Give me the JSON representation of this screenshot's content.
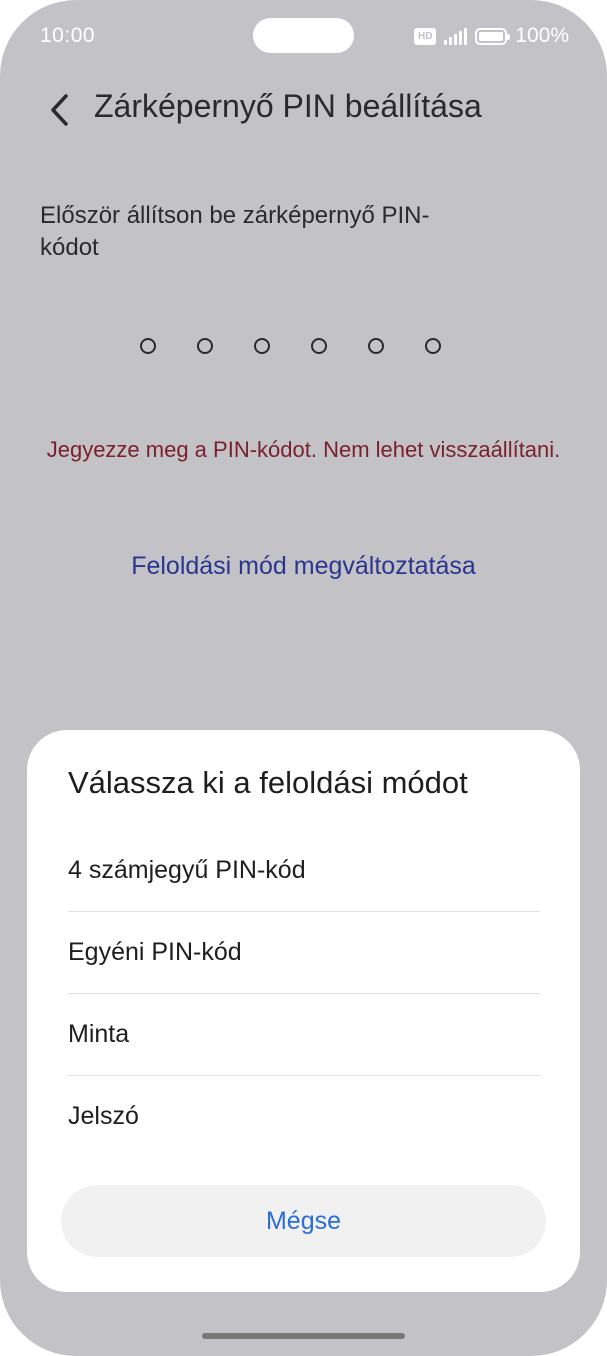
{
  "status_bar": {
    "time": "10:00",
    "hd_label": "HD",
    "battery": "100%"
  },
  "header": {
    "title": "Zárképernyő PIN beállítása",
    "back_icon": "chevron-left-icon"
  },
  "main": {
    "instruction": "Először állítson be zárképernyő PIN-kódot",
    "pin_length": 6,
    "warning": "Jegyezze meg a PIN-kódot. Nem lehet visszaállítani.",
    "change_mode_link": "Feloldási mód megváltoztatása"
  },
  "sheet": {
    "title": "Válassza ki a feloldási módot",
    "options": [
      {
        "label": "4 számjegyű PIN-kód"
      },
      {
        "label": "Egyéni PIN-kód"
      },
      {
        "label": "Minta"
      },
      {
        "label": "Jelszó"
      }
    ],
    "cancel_label": "Mégse"
  },
  "colors": {
    "backdrop": "#c3c3c7",
    "warning": "#7a1f2b",
    "link": "#2a3590",
    "cancel_text": "#2a6dd8"
  }
}
